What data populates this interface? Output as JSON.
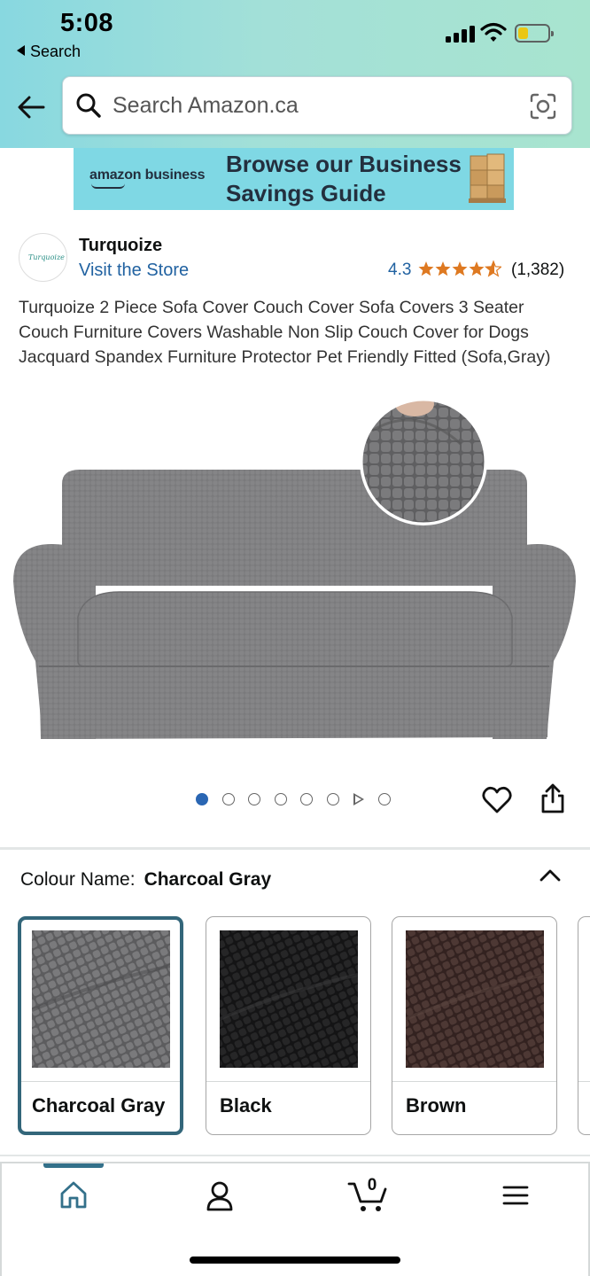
{
  "status_bar": {
    "time": "5:08",
    "back_app": "Search"
  },
  "search": {
    "placeholder": "Search Amazon.ca"
  },
  "banner": {
    "brand": "amazon business",
    "headline": "Browse our Business Savings Guide"
  },
  "store": {
    "name": "Turquoize",
    "logo_text": "Turquoize",
    "visit_label": "Visit the Store"
  },
  "rating": {
    "value": "4.3",
    "count": "(1,382)",
    "star_color": "#de7921"
  },
  "product": {
    "title": "Turquoize 2 Piece Sofa Cover Couch Cover Sofa Covers 3 Seater Couch Furniture Covers Washable Non Slip Couch Cover for Dogs Jacquard Spandex Furniture Protector Pet Friendly Fitted (Sofa,Gray)"
  },
  "carousel": {
    "total_images": 8,
    "current_index": 0,
    "video_index": 6
  },
  "colour": {
    "label": "Colour Name:",
    "selected": "Charcoal Gray",
    "options": [
      {
        "name": "Charcoal Gray",
        "swatch": "#6d6d6f",
        "selected": true
      },
      {
        "name": "Black",
        "swatch": "#1f1f20",
        "selected": false
      },
      {
        "name": "Brown",
        "swatch": "#4a3532",
        "selected": false
      }
    ]
  },
  "nav": {
    "cart_count": "0",
    "items": [
      "home-icon",
      "account-icon",
      "cart-icon",
      "menu-icon"
    ],
    "accent": "#33708a"
  }
}
